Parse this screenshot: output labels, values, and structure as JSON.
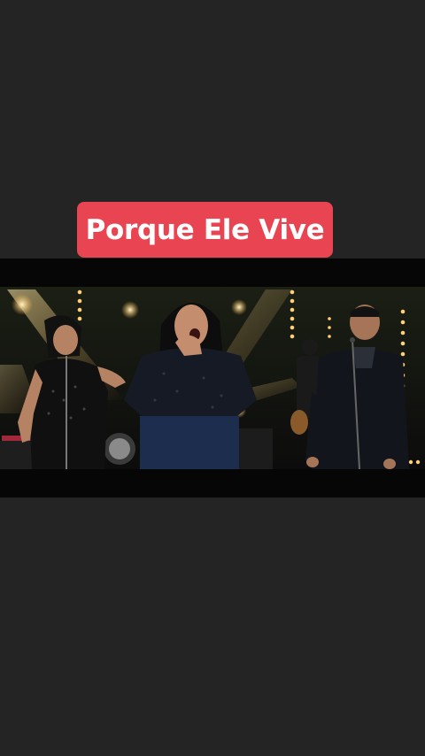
{
  "post": {
    "title": "Porque Ele Vive"
  },
  "colors": {
    "background": "#242424",
    "title_badge": "#e94451",
    "title_text": "#ffffff",
    "video_letterbox": "#060606"
  },
  "video": {
    "description_icon": "video-frame-concert-scene"
  }
}
